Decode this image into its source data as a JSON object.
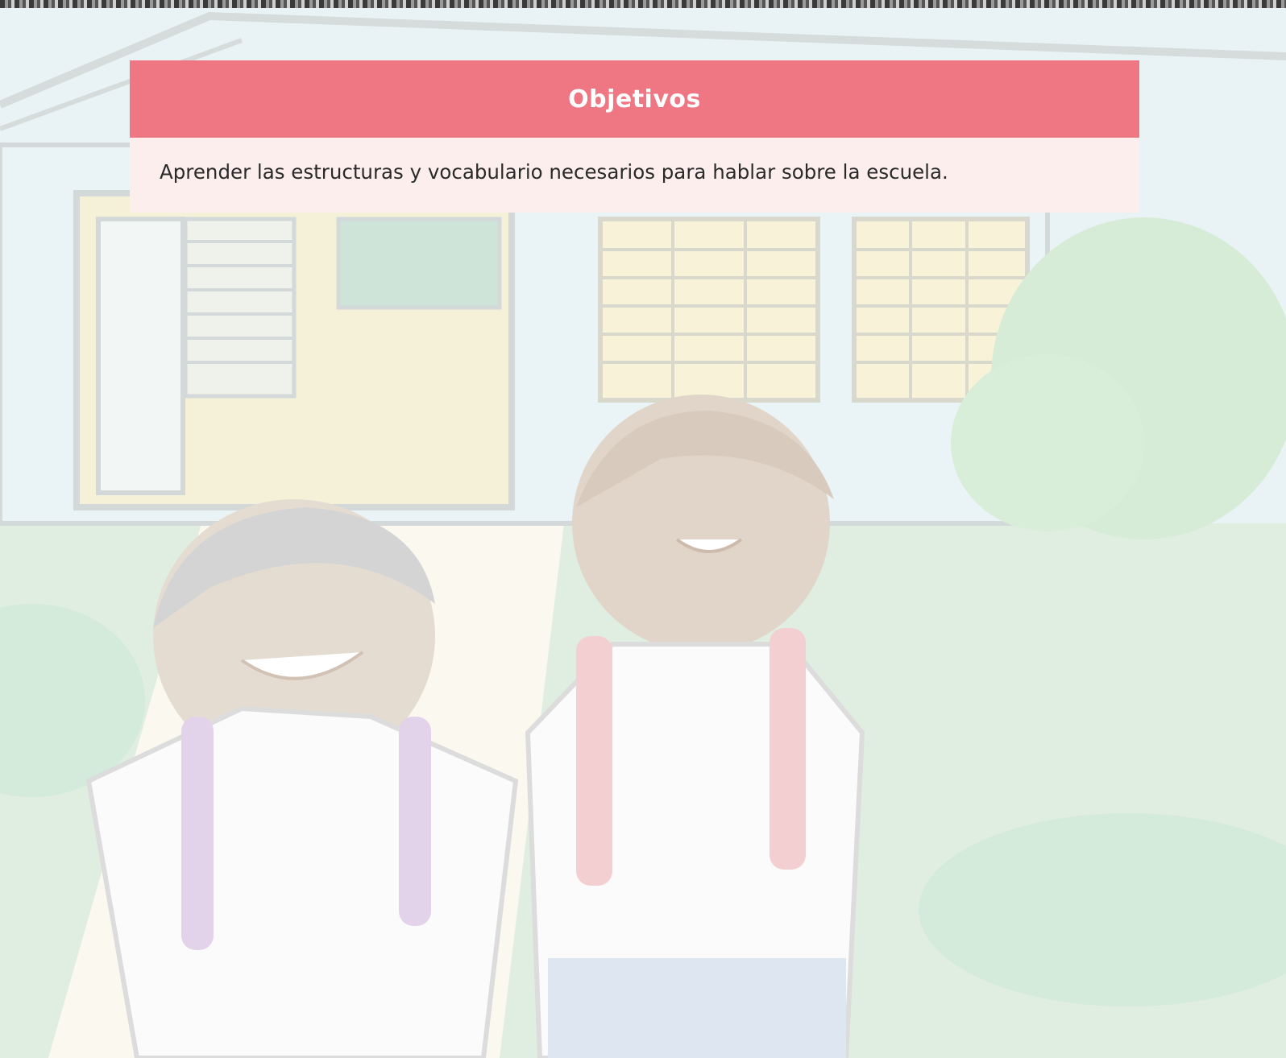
{
  "objectives": {
    "title": "Objetivos",
    "text": "Aprender las estructuras y vocabulario necesarios para hablar sobre la escuela."
  },
  "background": {
    "scene": "school-with-two-children-illustration"
  },
  "colors": {
    "header": "#ef7683",
    "body": "#fdeeee"
  }
}
